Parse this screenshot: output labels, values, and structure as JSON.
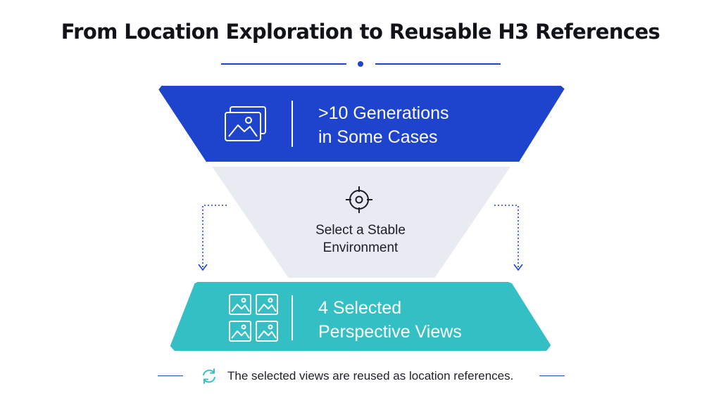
{
  "title": "From Location Exploration to Reusable H3 References",
  "stages": {
    "top": {
      "line1": ">10 Generations",
      "line2": "in Some Cases",
      "icon": "image-stack-icon",
      "color": "#1e43cc"
    },
    "middle": {
      "line1": "Select a Stable",
      "line2": "Environment",
      "icon": "crosshair-target-icon",
      "color": "#e9ebf2"
    },
    "bottom": {
      "line1": "4 Selected",
      "line2": "Perspective Views",
      "icon": "image-grid-icon",
      "color": "#33bfc4"
    }
  },
  "footer": {
    "text": "The selected views are reused as location references.",
    "icon": "refresh-cycle-icon"
  },
  "colors": {
    "accent": "#1f46c9",
    "teal": "#33bfc4"
  }
}
